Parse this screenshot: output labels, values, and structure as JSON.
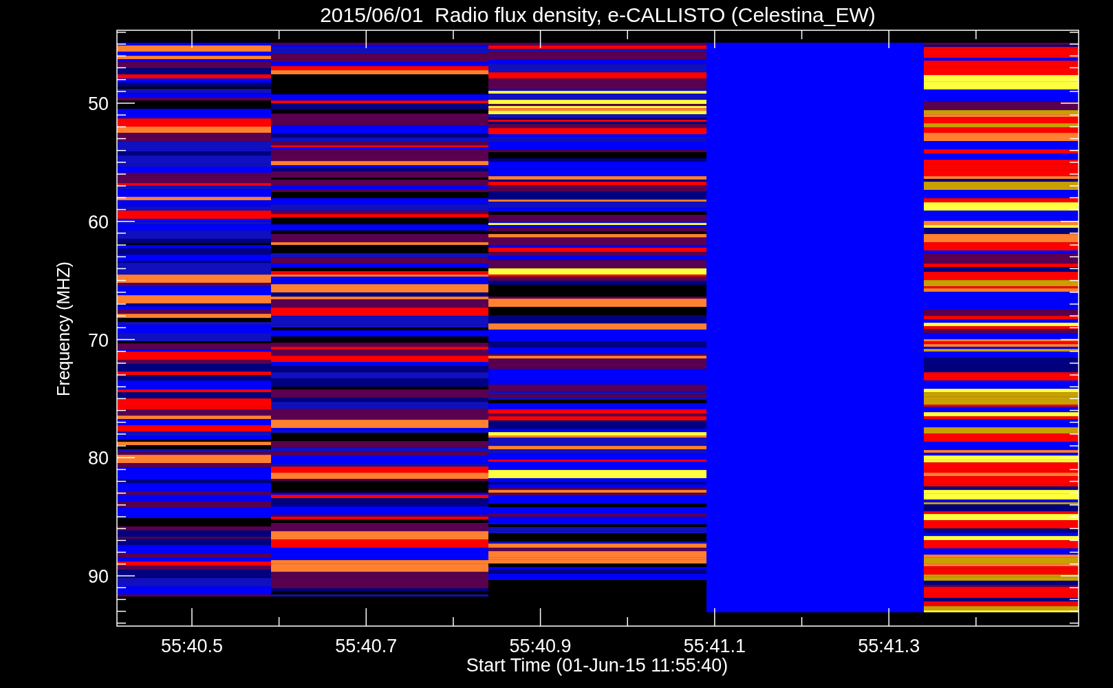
{
  "title": "2015/06/01  Radio flux density, e-CALLISTO (Celestina_EW)",
  "y_axis": {
    "label": "Frequency (MHZ)",
    "ticks": [
      "50",
      "60",
      "70",
      "80",
      "90"
    ]
  },
  "x_axis": {
    "label": "Start Time (01-Jun-15 11:55:40)",
    "ticks": [
      "55:40.5",
      "55:40.7",
      "55:40.9",
      "55:41.1",
      "55:41.3"
    ]
  }
}
